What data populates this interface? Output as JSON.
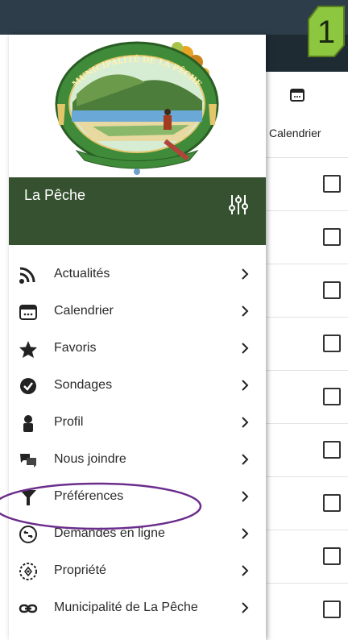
{
  "badge": {
    "number": "1",
    "color": "#8dc63f"
  },
  "background_app": {
    "calendar_tab_label": "Calendrier",
    "row_count": 9
  },
  "drawer": {
    "logo_text": "MUNICIPALITÉ DE LA PÊCHE",
    "municipality_name": "La Pêche",
    "header_color": "#35512f",
    "menu": [
      {
        "label": "Actualités",
        "icon": "rss-icon"
      },
      {
        "label": "Calendrier",
        "icon": "calendar-icon"
      },
      {
        "label": "Favoris",
        "icon": "star-icon"
      },
      {
        "label": "Sondages",
        "icon": "check-circle-icon"
      },
      {
        "label": "Profil",
        "icon": "person-icon"
      },
      {
        "label": "Nous joindre",
        "icon": "chat-icon"
      },
      {
        "label": "Préférences",
        "icon": "filter-icon"
      },
      {
        "label": "Demandes en ligne",
        "icon": "online-request-icon"
      },
      {
        "label": "Propriété",
        "icon": "property-icon"
      },
      {
        "label": "Municipalité de La Pêche",
        "icon": "link-icon"
      }
    ],
    "highlighted_item": "Préférences",
    "highlight_color": "#6b2d8c"
  }
}
